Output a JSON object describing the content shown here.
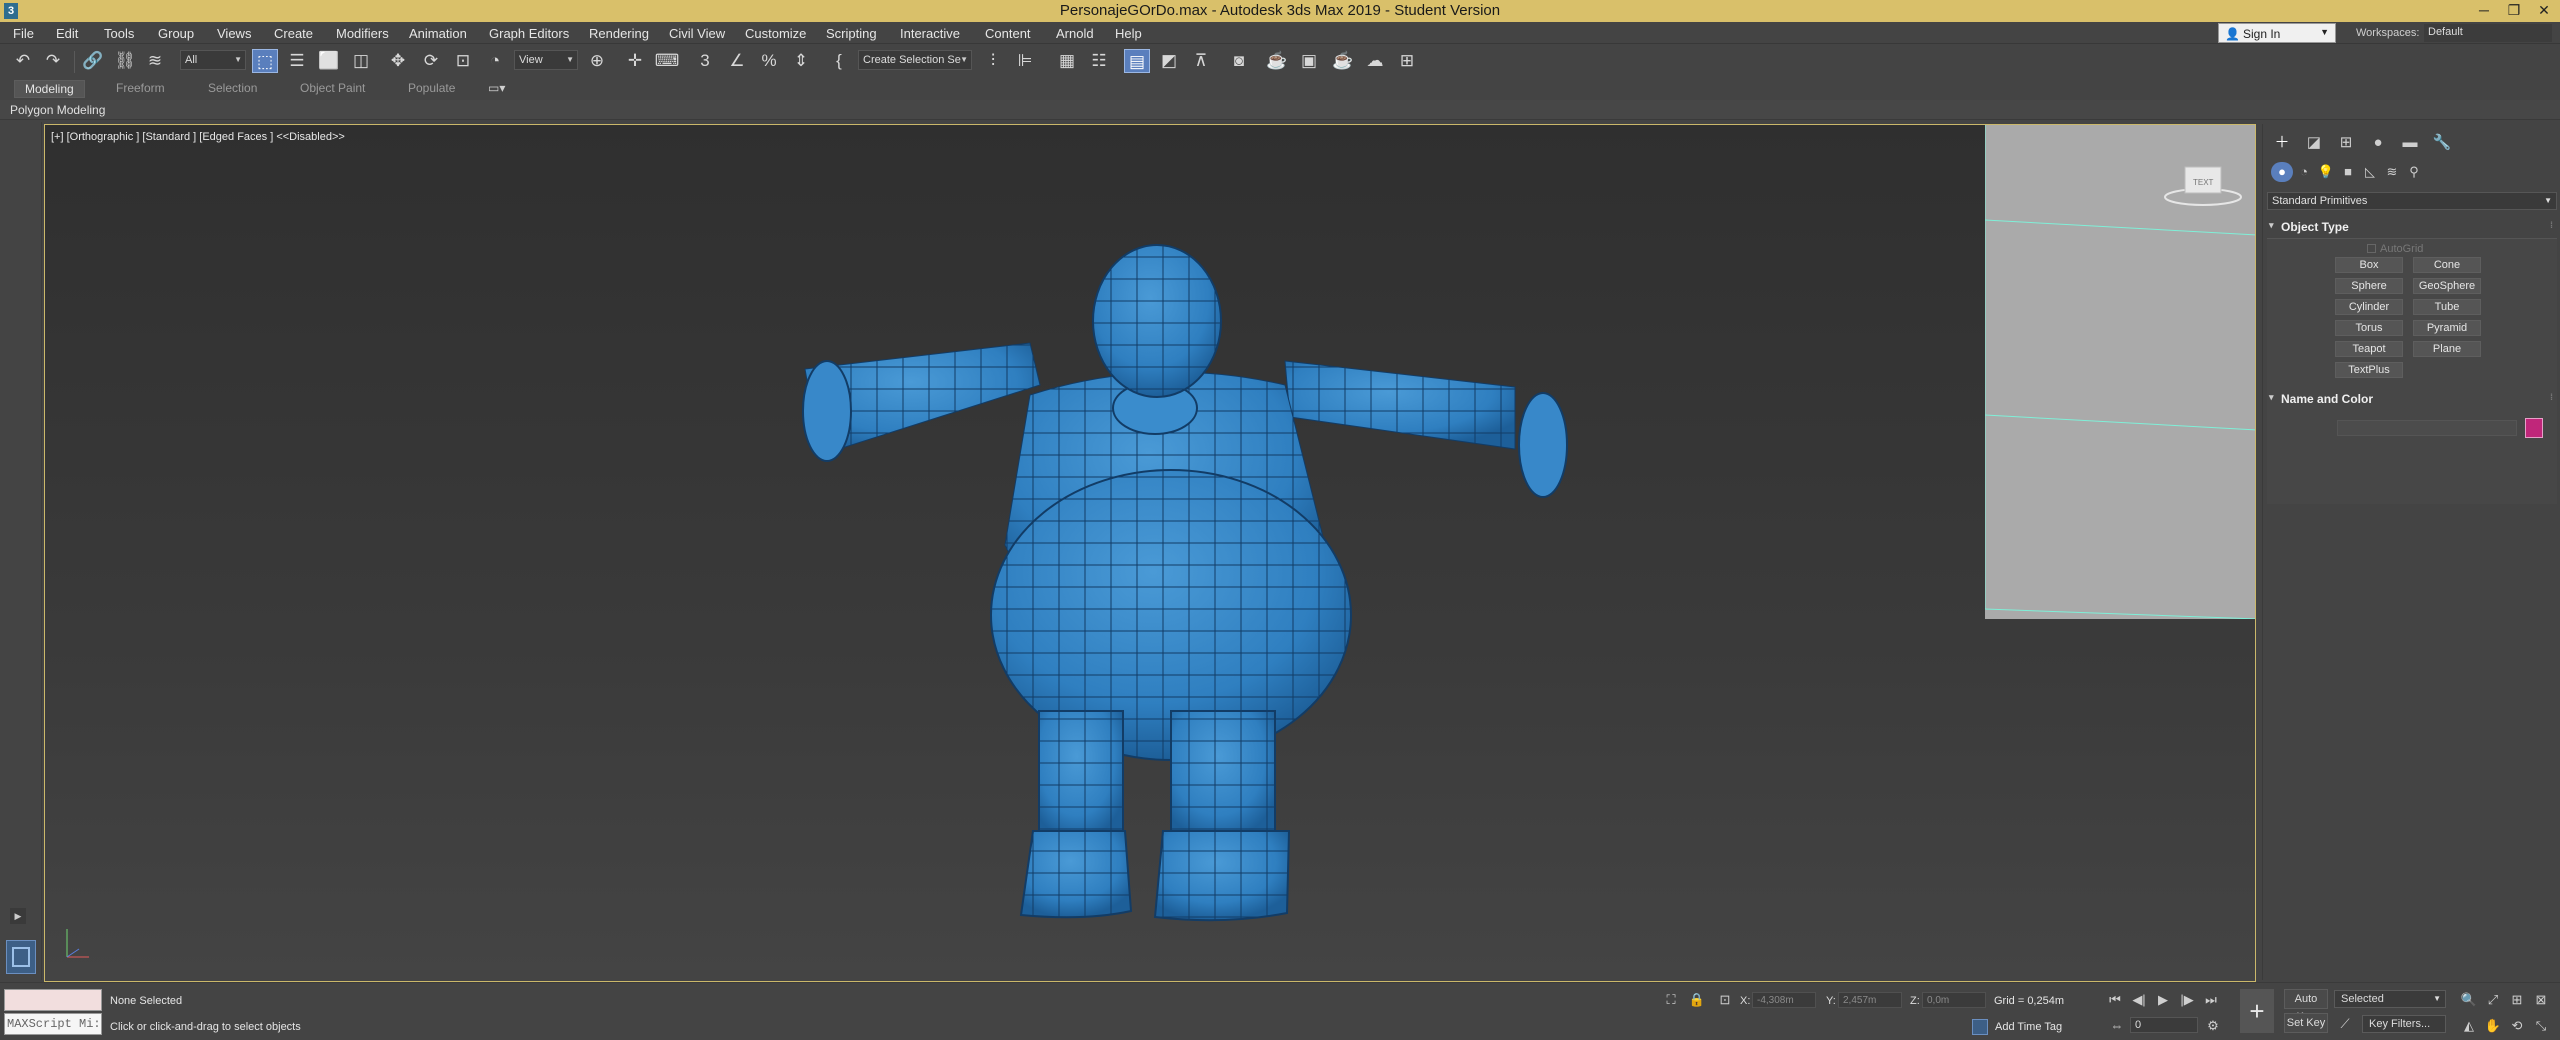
{
  "window": {
    "title": "PersonajeGOrDo.max - Autodesk 3ds Max 2019 - Student Version",
    "app_icon": "3",
    "controls": [
      "minimize-icon",
      "maximize-icon",
      "close-icon"
    ]
  },
  "menu": {
    "items": [
      "File",
      "Edit",
      "Tools",
      "Group",
      "Views",
      "Create",
      "Modifiers",
      "Animation",
      "Graph Editors",
      "Rendering",
      "Civil View",
      "Customize",
      "Scripting",
      "Interactive",
      "Content",
      "Arnold",
      "Help"
    ],
    "sign_in": "Sign In",
    "workspaces_label": "Workspaces:",
    "workspaces_value": "Default"
  },
  "toolbar": {
    "selection_filter": "All",
    "reference_coord": "View",
    "named_selection": "Create Selection Se"
  },
  "ribbon": {
    "tabs": [
      "Modeling",
      "Freeform",
      "Selection",
      "Object Paint",
      "Populate"
    ],
    "active_tab": "Modeling",
    "panel": "Polygon Modeling"
  },
  "viewport": {
    "label": "[+] [Orthographic ] [Standard ] [Edged Faces ]  <<Disabled>>",
    "viewcube_text": "TEXT",
    "mesh_color": "#2f7fc0",
    "wire_color": "#123c66",
    "border_color": "#cbb86a"
  },
  "command_panel": {
    "category": "Standard Primitives",
    "object_type_title": "Object Type",
    "autogrid": "AutoGrid",
    "buttons": [
      "Box",
      "Cone",
      "Sphere",
      "GeoSphere",
      "Cylinder",
      "Tube",
      "Torus",
      "Pyramid",
      "Teapot",
      "Plane",
      "TextPlus"
    ],
    "name_color_title": "Name and Color",
    "swatch_color": "#c0267a"
  },
  "status": {
    "maxscript": "MAXScript Mi:",
    "selection": "None Selected",
    "prompt": "Click or click-and-drag to select objects",
    "x_label": "X:",
    "x_value": "-4,308m",
    "y_label": "Y:",
    "y_value": "2,457m",
    "z_label": "Z:",
    "z_value": "0,0m",
    "grid": "Grid = 0,254m",
    "add_time_tag": "Add Time Tag",
    "frame": "0",
    "auto_key": "Auto Key",
    "set_key": "Set Key",
    "key_mode": "Selected",
    "key_filters": "Key Filters..."
  }
}
